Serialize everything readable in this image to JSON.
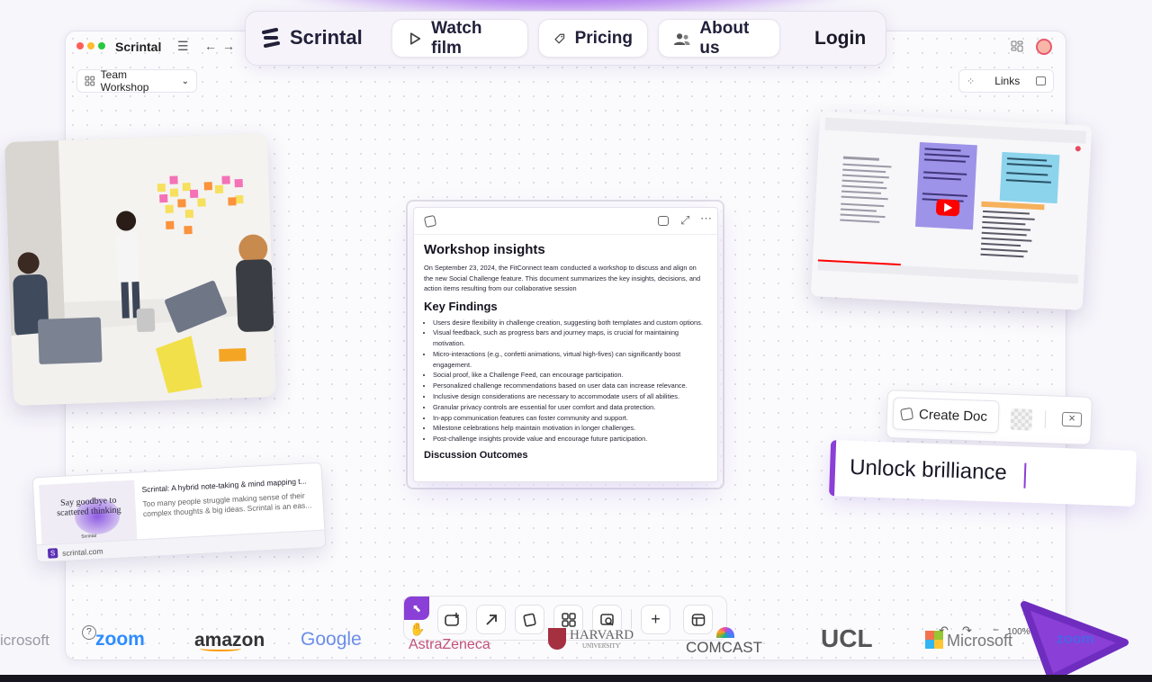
{
  "app": {
    "window_title": "Scrintal",
    "workspace": "Team Workshop",
    "links_label": "Links",
    "help_label": "?",
    "zoom_level": "100%"
  },
  "nav": {
    "brand": "Scrintal",
    "watch_film": "Watch film",
    "pricing": "Pricing",
    "about_us": "About us",
    "login": "Login"
  },
  "doc": {
    "title": "Workshop insights",
    "intro": "On September 23, 2024, the FitConnect team conducted a workshop to discuss and align on the new Social Challenge feature. This document summarizes the key insights, decisions, and action items resulting from our collaborative session",
    "findings_heading": "Key Findings",
    "findings": [
      "Users desire flexibility in challenge creation, suggesting both templates and custom options.",
      "Visual feedback, such as progress bars and journey maps, is crucial for maintaining motivation.",
      "Micro-interactions (e.g., confetti animations, virtual high-fives) can significantly boost engagement.",
      "Social proof, like a Challenge Feed, can encourage participation.",
      "Personalized challenge recommendations based on user data can increase relevance.",
      "Inclusive design considerations are necessary to accommodate users of all abilities.",
      "Granular privacy controls are essential for user comfort and data protection.",
      "In-app communication features can foster community and support.",
      "Milestone celebrations help maintain motivation in longer challenges.",
      "Post-challenge insights provide value and encourage future participation."
    ],
    "outcomes_heading": "Discussion Outcomes"
  },
  "link_card": {
    "thumb_text": "Say goodbye to scattered thinking",
    "thumb_brand": "Scrintal",
    "title": "Scrintal: A hybrid note-taking & mind mapping t...",
    "desc": "Too many people struggle making sense of their complex thoughts & big ideas. Scrintal is an eas...",
    "domain": "scrintal.com"
  },
  "create_doc": {
    "label": "Create Doc"
  },
  "unlock": {
    "text": "Unlock brilliance"
  },
  "logos": [
    "icrosoft",
    "zoom",
    "amazon",
    "Google",
    "AstraZeneca",
    "HARVARD",
    "UNIVERSITY",
    "COMCAST",
    "UCL",
    "Microsoft",
    "zoom"
  ],
  "colors": {
    "accent": "#8a3fd6",
    "brand_dark": "#22203a",
    "zoom_blue": "#2d8cff",
    "youtube_red": "#ff0000"
  }
}
